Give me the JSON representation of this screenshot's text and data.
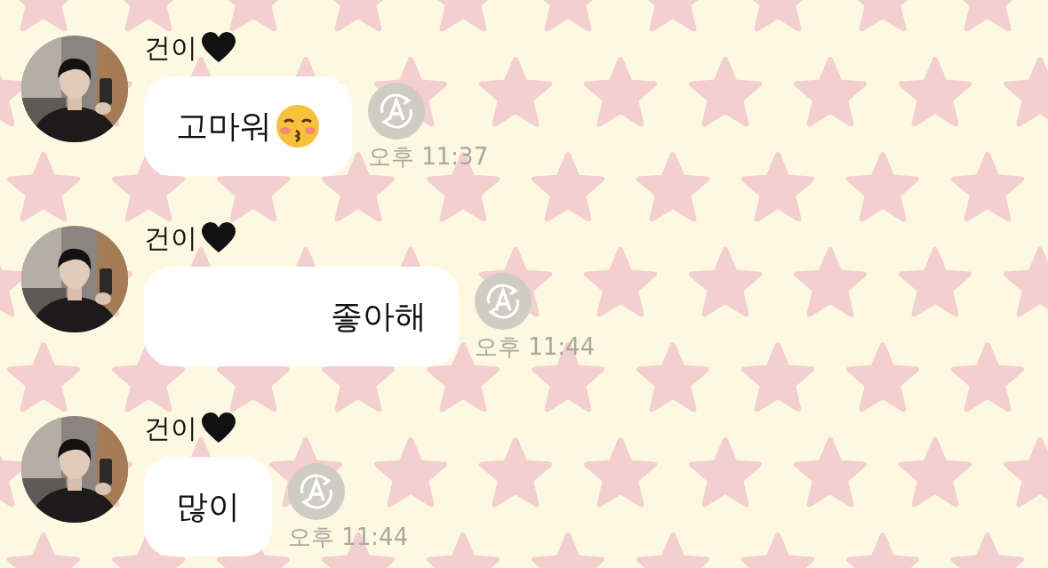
{
  "messages": [
    {
      "sender": "건이",
      "text": "고마워",
      "kind": "with_emoji",
      "redacted_prefix": false,
      "time": "오후 11:37"
    },
    {
      "sender": "건이",
      "text": "좋아해",
      "kind": "plain",
      "redacted_prefix": true,
      "time": "오후 11:44"
    },
    {
      "sender": "건이",
      "text": "많이",
      "kind": "plain",
      "redacted_prefix": false,
      "time": "오후 11:44"
    }
  ]
}
